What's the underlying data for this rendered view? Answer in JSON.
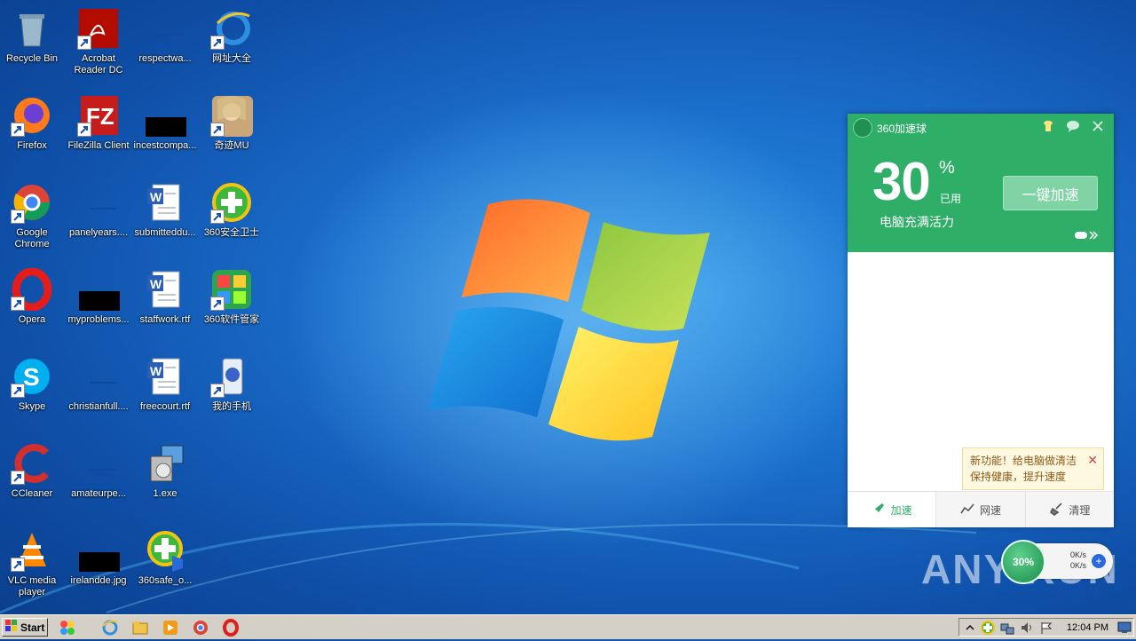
{
  "desktop": {
    "icons": [
      {
        "label": "Recycle Bin"
      },
      {
        "label": "Acrobat Reader DC"
      },
      {
        "label": "respectwa..."
      },
      {
        "label": "网址大全"
      },
      {
        "label": "Firefox"
      },
      {
        "label": "FileZilla Client"
      },
      {
        "label": "incestcompa..."
      },
      {
        "label": "奇迹MU"
      },
      {
        "label": "Google Chrome"
      },
      {
        "label": "panelyears...."
      },
      {
        "label": "submitteddu..."
      },
      {
        "label": "360安全卫士"
      },
      {
        "label": "Opera"
      },
      {
        "label": "myproblems..."
      },
      {
        "label": "staffwork.rtf"
      },
      {
        "label": "360软件管家"
      },
      {
        "label": "Skype"
      },
      {
        "label": "christianfull...."
      },
      {
        "label": "freecourt.rtf"
      },
      {
        "label": "我的手机"
      },
      {
        "label": "CCleaner"
      },
      {
        "label": "amateurpe..."
      },
      {
        "label": "1.exe"
      },
      {
        "label": "VLC media player"
      },
      {
        "label": "irelandde.jpg"
      },
      {
        "label": "360safe_o..."
      }
    ]
  },
  "panel": {
    "title": "360加速球",
    "percent": "30",
    "percent_sign": "%",
    "used_label": "已用",
    "subtitle": "电脑充满活力",
    "boost_button": "一键加速",
    "tooltip_line1": "新功能！给电脑做清洁",
    "tooltip_line2": "保持健康，提升速度",
    "tabs": [
      "加速",
      "网速",
      "清理"
    ],
    "accent_color": "#2fae68"
  },
  "speed_ball": {
    "percent": "30%",
    "up": "0K/s",
    "down": "0K/s"
  },
  "taskbar": {
    "start_label": "Start",
    "clock": "12:04 PM"
  },
  "watermark": "ANY RUN"
}
